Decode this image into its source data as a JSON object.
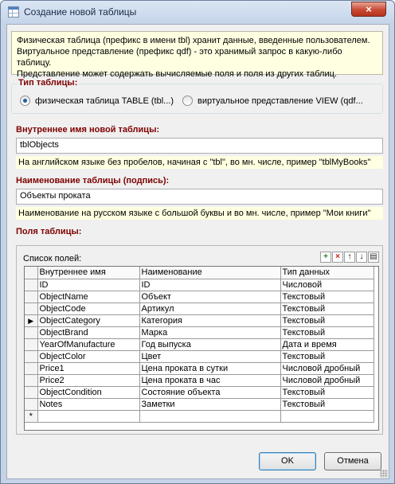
{
  "window": {
    "title": "Создание новой таблицы",
    "close_glyph": "×"
  },
  "info": {
    "lines": [
      "Физическая таблица (префикс в имени tbl) хранит данные, введенные пользователем.",
      "Виртуальное представление (префикс qdf) - это хранимый запрос в какую-либо таблицу.",
      "Представление может содержать вычисляемые поля и поля из других таблиц."
    ]
  },
  "table_type": {
    "legend": "Тип таблицы:",
    "options": [
      {
        "label": "физическая таблица TABLE (tbl...)",
        "selected": true
      },
      {
        "label": "виртуальное представление VIEW (qdf...",
        "selected": false
      }
    ]
  },
  "internal_name": {
    "label": "Внутреннее имя новой таблицы:",
    "value": "tblObjects",
    "hint": "На английском языке без пробелов, начиная с \"tbl\", во мн. числе, пример \"tblMyBooks\""
  },
  "caption": {
    "label": "Наименование таблицы (подпись):",
    "value": "Объекты проката",
    "hint": "Наименование на русском языке с большой буквы и во мн. числе, пример \"Мои книги\""
  },
  "fields": {
    "label": "Поля таблицы:",
    "list_caption": "Список полей:",
    "toolbar": [
      {
        "icon": "add-icon",
        "glyph": "+",
        "color": "#1e8a1e"
      },
      {
        "icon": "delete-icon",
        "glyph": "×",
        "color": "#c81e1e"
      },
      {
        "icon": "move-up-icon",
        "glyph": "↑",
        "color": "#000000"
      },
      {
        "icon": "move-down-icon",
        "glyph": "↓",
        "color": "#000000"
      },
      {
        "icon": "copy-icon",
        "glyph": "▤",
        "color": "#333333"
      }
    ],
    "columns": [
      "Внутреннее имя",
      "Наименование",
      "Тип данных"
    ],
    "current_row": 3,
    "new_row_marker": "*",
    "rows": [
      [
        "ID",
        "ID",
        "Числовой"
      ],
      [
        "ObjectName",
        "Объект",
        "Текстовый"
      ],
      [
        "ObjectCode",
        "Артикул",
        "Текстовый"
      ],
      [
        "ObjectCategory",
        "Категория",
        "Текстовый"
      ],
      [
        "ObjectBrand",
        "Марка",
        "Текстовый"
      ],
      [
        "YearOfManufacture",
        "Год выпуска",
        "Дата и время"
      ],
      [
        "ObjectColor",
        "Цвет",
        "Текстовый"
      ],
      [
        "Price1",
        "Цена проката в сутки",
        "Числовой дробный"
      ],
      [
        "Price2",
        "Цена проката в час",
        "Числовой дробный"
      ],
      [
        "ObjectCondition",
        "Состояние объекта",
        "Текстовый"
      ],
      [
        "Notes",
        "Заметки",
        "Текстовый"
      ]
    ]
  },
  "buttons": {
    "ok": "OK",
    "cancel": "Отмена"
  }
}
